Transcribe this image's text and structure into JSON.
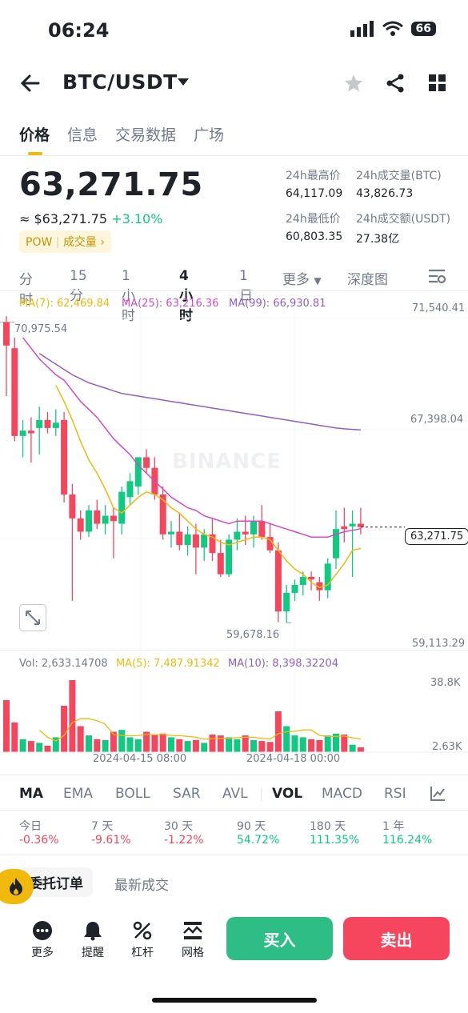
{
  "status": {
    "time": "06:24",
    "battery": "66"
  },
  "header": {
    "pair": "BTC/USDT"
  },
  "tabs": [
    "价格",
    "信息",
    "交易数据",
    "广场"
  ],
  "price": {
    "last": "63,271.75",
    "approx": "≈ $63,271.75",
    "change": "+3.10%",
    "tag_pow": "POW",
    "tag_vol": "成交量 ›"
  },
  "stats": {
    "high_label": "24h最高价",
    "high": "64,117.09",
    "vol_btc_label": "24h成交量(BTC)",
    "vol_btc": "43,826.73",
    "low_label": "24h最低价",
    "low": "60,803.35",
    "vol_usdt_label": "24h成交额(USDT)",
    "vol_usdt": "27.38亿"
  },
  "intervals": [
    "分时",
    "15分",
    "1小时",
    "4小时",
    "1日",
    "更多",
    "深度图"
  ],
  "ma_legend": {
    "ma7": "MA(7): 62,469.84",
    "ma25": "MA(25): 63,216.36",
    "ma99": "MA(99): 66,930.81"
  },
  "axis": {
    "p_top": "71,540.41",
    "p_mid": "67,398.04",
    "p_current": "63,271.75",
    "p_bottom": "59,113.29",
    "high_mark": "70,975.54",
    "low_mark": "59,678.16",
    "vol_top": "38.8K",
    "vol_bottom": "2.63K",
    "date1": "2024-04-15 08:00",
    "date2": "2024-04-18 00:00"
  },
  "watermark": "BINANCE",
  "vol_legend": {
    "vol": "Vol: 2,633.14708",
    "ma5": "MA(5): 7,487.91342",
    "ma10": "MA(10): 8,398.32204"
  },
  "indicators": [
    "MA",
    "EMA",
    "BOLL",
    "SAR",
    "AVL",
    "VOL",
    "MACD",
    "RSI"
  ],
  "performance": [
    {
      "label": "今日",
      "value": "-0.36%"
    },
    {
      "label": "7 天",
      "value": "-9.61%"
    },
    {
      "label": "30 天",
      "value": "-1.22%"
    },
    {
      "label": "90 天",
      "value": "54.72%"
    },
    {
      "label": "180 天",
      "value": "111.35%"
    },
    {
      "label": "1 年",
      "value": "116.24%"
    }
  ],
  "bottom_tabs": [
    "委托订单",
    "最新成交"
  ],
  "nav": [
    "更多",
    "提醒",
    "杠杆",
    "网格"
  ],
  "actions": {
    "buy": "买入",
    "sell": "卖出"
  },
  "colors": {
    "up": "#0ecb81",
    "down": "#f6465d",
    "accent": "#f0b90b",
    "ma7": "#f0b90b",
    "ma25": "#d847c6",
    "ma99": "#8f5ec8"
  },
  "chart_data": {
    "type": "candlestick",
    "price_range": [
      59113.29,
      71540.41
    ],
    "candles": [
      {
        "o": 70975,
        "h": 71200,
        "l": 68200,
        "c": 70100
      },
      {
        "o": 70000,
        "h": 70400,
        "l": 66500,
        "c": 66700
      },
      {
        "o": 66700,
        "h": 67300,
        "l": 65900,
        "c": 66900
      },
      {
        "o": 66900,
        "h": 67400,
        "l": 65700,
        "c": 66800
      },
      {
        "o": 67000,
        "h": 67800,
        "l": 66000,
        "c": 67300
      },
      {
        "o": 67300,
        "h": 67600,
        "l": 66800,
        "c": 67000
      },
      {
        "o": 67000,
        "h": 67700,
        "l": 66700,
        "c": 67200
      },
      {
        "o": 67300,
        "h": 67600,
        "l": 64200,
        "c": 64500
      },
      {
        "o": 64500,
        "h": 64900,
        "l": 60500,
        "c": 63600
      },
      {
        "o": 63600,
        "h": 63900,
        "l": 62800,
        "c": 63100
      },
      {
        "o": 63100,
        "h": 64100,
        "l": 62900,
        "c": 63900
      },
      {
        "o": 63900,
        "h": 64300,
        "l": 63200,
        "c": 63400
      },
      {
        "o": 63400,
        "h": 64100,
        "l": 63000,
        "c": 63700
      },
      {
        "o": 63700,
        "h": 64000,
        "l": 62100,
        "c": 63500
      },
      {
        "o": 63400,
        "h": 64800,
        "l": 63000,
        "c": 64600
      },
      {
        "o": 64400,
        "h": 65300,
        "l": 64100,
        "c": 65000
      },
      {
        "o": 64800,
        "h": 65900,
        "l": 64500,
        "c": 65900
      },
      {
        "o": 65900,
        "h": 66200,
        "l": 65300,
        "c": 65500
      },
      {
        "o": 65500,
        "h": 65900,
        "l": 64300,
        "c": 64500
      },
      {
        "o": 64500,
        "h": 64800,
        "l": 62800,
        "c": 63000
      },
      {
        "o": 63000,
        "h": 63500,
        "l": 62500,
        "c": 63100
      },
      {
        "o": 63100,
        "h": 63800,
        "l": 62400,
        "c": 62600
      },
      {
        "o": 62600,
        "h": 63300,
        "l": 62200,
        "c": 63000
      },
      {
        "o": 63000,
        "h": 63400,
        "l": 61500,
        "c": 62500
      },
      {
        "o": 62500,
        "h": 63200,
        "l": 62000,
        "c": 63000
      },
      {
        "o": 63000,
        "h": 63600,
        "l": 62000,
        "c": 62300
      },
      {
        "o": 62300,
        "h": 62800,
        "l": 61400,
        "c": 61500
      },
      {
        "o": 61500,
        "h": 63000,
        "l": 61400,
        "c": 62800
      },
      {
        "o": 62800,
        "h": 63600,
        "l": 62400,
        "c": 63100
      },
      {
        "o": 63100,
        "h": 63700,
        "l": 62600,
        "c": 63000
      },
      {
        "o": 63000,
        "h": 63700,
        "l": 62500,
        "c": 63500
      },
      {
        "o": 63500,
        "h": 64100,
        "l": 62800,
        "c": 62900
      },
      {
        "o": 62900,
        "h": 63400,
        "l": 62300,
        "c": 62400
      },
      {
        "o": 62400,
        "h": 62700,
        "l": 59700,
        "c": 60100
      },
      {
        "o": 60100,
        "h": 61100,
        "l": 59678,
        "c": 60800
      },
      {
        "o": 60800,
        "h": 61300,
        "l": 60500,
        "c": 61100
      },
      {
        "o": 61100,
        "h": 61600,
        "l": 60700,
        "c": 61400
      },
      {
        "o": 61400,
        "h": 61600,
        "l": 60900,
        "c": 61300
      },
      {
        "o": 61200,
        "h": 61400,
        "l": 60500,
        "c": 60900
      },
      {
        "o": 60900,
        "h": 62100,
        "l": 60600,
        "c": 61900
      },
      {
        "o": 62100,
        "h": 63900,
        "l": 61700,
        "c": 63200
      },
      {
        "o": 63300,
        "h": 64000,
        "l": 62700,
        "c": 63200
      },
      {
        "o": 63300,
        "h": 63900,
        "l": 61400,
        "c": 63400
      },
      {
        "o": 63400,
        "h": 64000,
        "l": 63000,
        "c": 63271.75
      }
    ],
    "volumes": [
      28000,
      16000,
      7000,
      6000,
      5000,
      3500,
      8000,
      25000,
      38800,
      14000,
      9000,
      7000,
      6500,
      11000,
      12000,
      8000,
      7000,
      11000,
      9500,
      10000,
      8000,
      7000,
      6000,
      6500,
      5000,
      9500,
      9000,
      8000,
      7000,
      9000,
      6500,
      6000,
      5500,
      22000,
      14000,
      9000,
      8000,
      7000,
      6500,
      9000,
      10000,
      9500,
      4000,
      2630
    ],
    "ma7": [
      null,
      null,
      null,
      null,
      null,
      null,
      68600,
      68000,
      67300,
      66500,
      65800,
      65300,
      64700,
      64000,
      63800,
      64100,
      64400,
      64600,
      64500,
      64300,
      64000,
      63800,
      63500,
      63200,
      63000,
      62900,
      62700,
      62600,
      62700,
      62800,
      62900,
      62900,
      62800,
      62400,
      62000,
      61700,
      61500,
      61200,
      61000,
      61100,
      61500,
      61900,
      62400,
      62470
    ],
    "ma25": [
      null,
      null,
      70400,
      70000,
      69600,
      69300,
      69000,
      68800,
      68400,
      68000,
      67700,
      67400,
      67000,
      66600,
      66300,
      66000,
      65600,
      65300,
      65000,
      64700,
      64400,
      64200,
      64000,
      63900,
      63700,
      63600,
      63500,
      63400,
      63500,
      63500,
      63500,
      63500,
      63400,
      63300,
      63200,
      63100,
      63000,
      62900,
      62900,
      62900,
      63000,
      63100,
      63150,
      63216
    ],
    "ma99": [
      null,
      null,
      null,
      null,
      69800,
      69600,
      69400,
      69200,
      69000,
      68850,
      68700,
      68600,
      68500,
      68400,
      68300,
      68250,
      68200,
      68150,
      68100,
      68050,
      68000,
      67950,
      67900,
      67850,
      67800,
      67750,
      67700,
      67650,
      67600,
      67550,
      67500,
      67450,
      67400,
      67350,
      67300,
      67250,
      67200,
      67150,
      67100,
      67050,
      67000,
      66970,
      66950,
      66930
    ],
    "vol_ma5": [
      null,
      null,
      null,
      null,
      12000,
      8000,
      6000,
      9000,
      16000,
      18000,
      18000,
      17000,
      15000,
      9500,
      9000,
      8800,
      9000,
      9500,
      9300,
      9500,
      9000,
      8900,
      8500,
      8000,
      7000,
      7300,
      7500,
      7500,
      7800,
      8000,
      8000,
      7500,
      7000,
      10000,
      11000,
      11200,
      12000,
      12000,
      9000,
      8500,
      8500,
      8700,
      7700,
      7100
    ]
  }
}
